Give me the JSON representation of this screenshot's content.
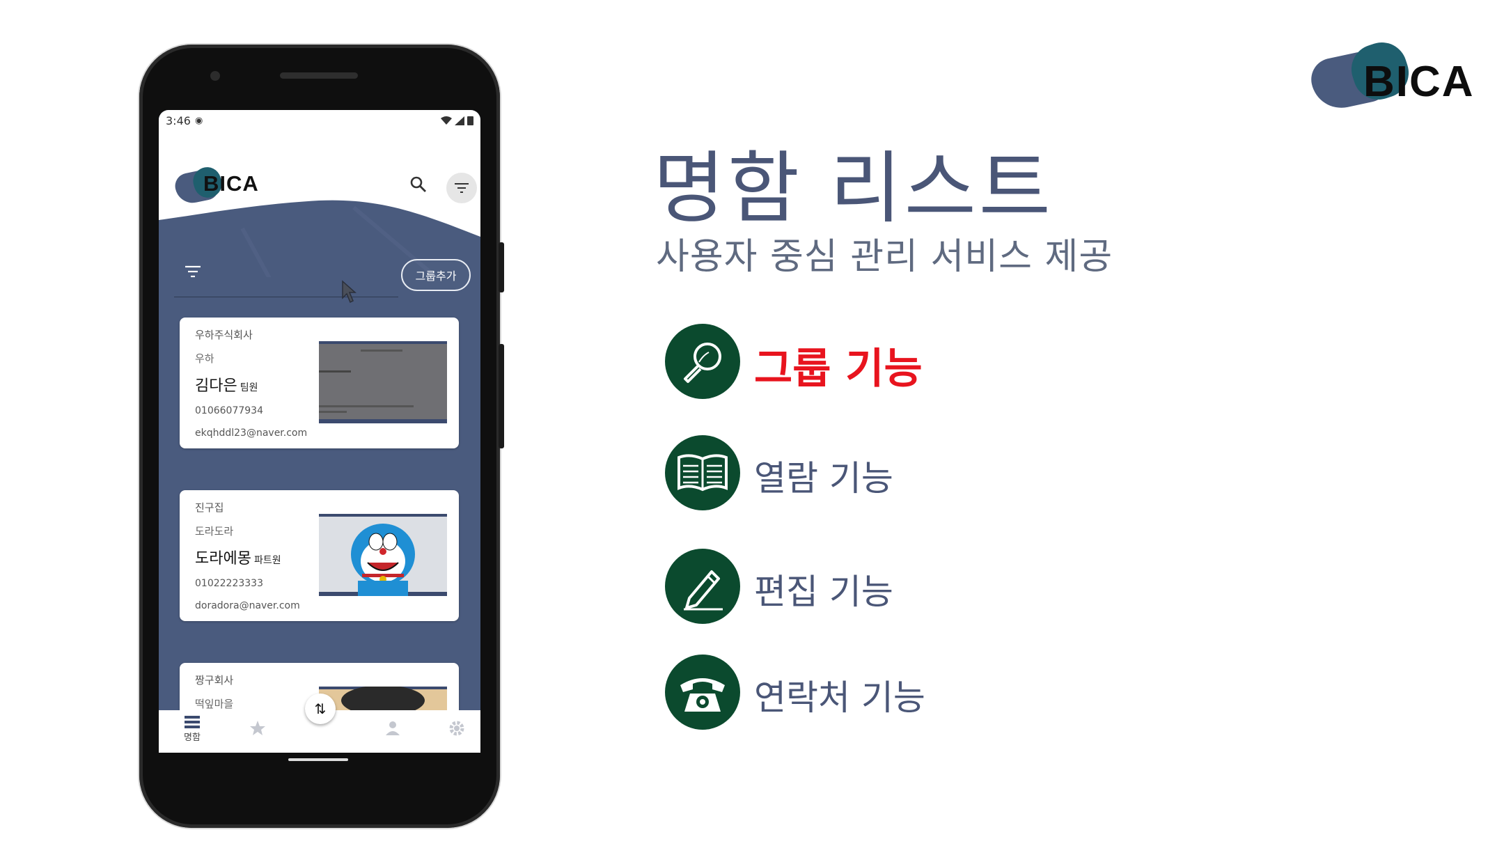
{
  "status_bar": {
    "time": "3:46"
  },
  "app": {
    "logo_text": "BICA",
    "group_add_label": "그룹추가",
    "cards": [
      {
        "company": "우하주식회사",
        "dept": "우하",
        "name": "김다은",
        "position": "팀원",
        "phone": "01066077934",
        "email": "ekqhddl23@naver.com"
      },
      {
        "company": "진구집",
        "dept": "도라도라",
        "name": "도라에몽",
        "position": "파트원",
        "phone": "01022223333",
        "email": "doradora@naver.com"
      },
      {
        "company": "짱구회사",
        "dept": "떡잎마을"
      }
    ],
    "bottom_nav": {
      "cards_label": "명함"
    }
  },
  "slide": {
    "brand_logo": "BICA",
    "title": "명함 리스트",
    "subtitle": "사용자 중심 관리 서비스 제공",
    "features": [
      {
        "label": "그룹 기능",
        "icon": "magnifier-icon",
        "active": true
      },
      {
        "label": "열람 기능",
        "icon": "book-icon",
        "active": false
      },
      {
        "label": "편집 기능",
        "icon": "pencil-icon",
        "active": false
      },
      {
        "label": "연락처 기능",
        "icon": "telephone-icon",
        "active": false
      }
    ]
  },
  "colors": {
    "brand_navy": "#4a5b7e",
    "brand_teal": "#1f5f6e",
    "feature_green": "#0b4a2e",
    "active_red": "#e8141e"
  }
}
